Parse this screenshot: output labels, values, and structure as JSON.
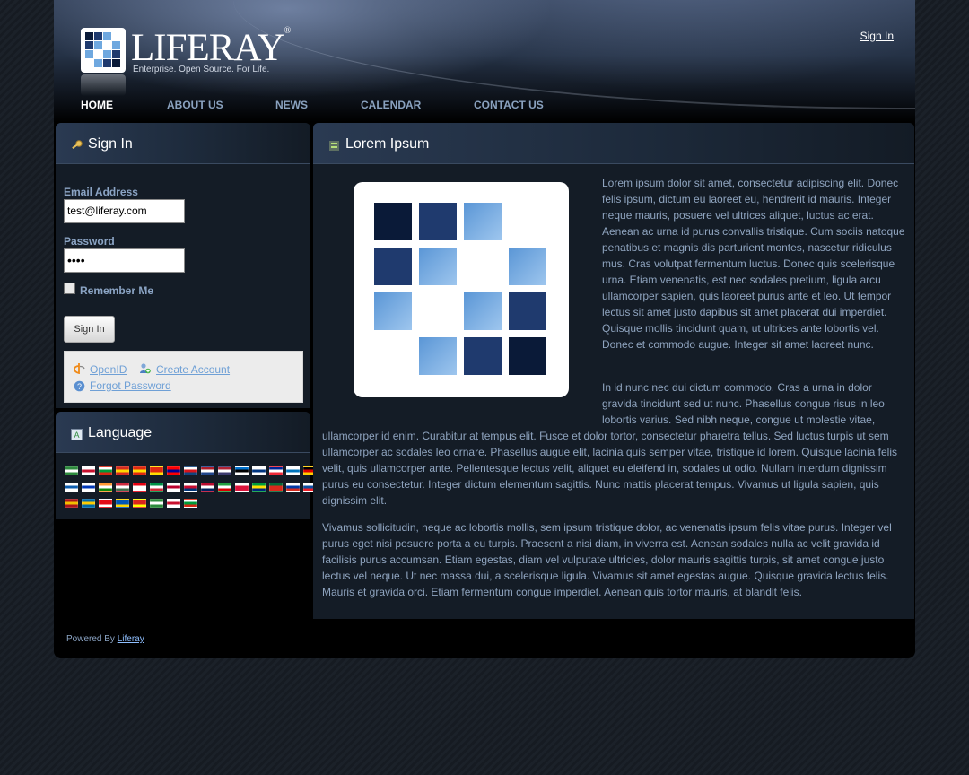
{
  "header": {
    "logo_word": "LIFERAY",
    "logo_tagline": "Enterprise. Open Source. For Life.",
    "sign_in_link": "Sign In"
  },
  "nav": {
    "items": [
      {
        "label": "HOME"
      },
      {
        "label": "ABOUT US"
      },
      {
        "label": "NEWS"
      },
      {
        "label": "CALENDAR"
      },
      {
        "label": "CONTACT US"
      }
    ]
  },
  "signin": {
    "title": "Sign In",
    "email_label": "Email Address",
    "email_value": "test@liferay.com",
    "password_label": "Password",
    "password_value": "••••",
    "remember_label": "Remember Me",
    "button": "Sign In",
    "openid": "OpenID",
    "create_account": "Create Account",
    "forgot_password": "Forgot Password"
  },
  "language": {
    "title": "Language",
    "flag_count": 38
  },
  "lorem": {
    "title": "Lorem Ipsum",
    "para1": "Lorem ipsum dolor sit amet, consectetur adipiscing elit. Donec felis ipsum, dictum eu laoreet eu, hendrerit id mauris. Integer neque mauris, posuere vel ultrices aliquet, luctus ac erat. Aenean ac urna id purus convallis tristique. Cum sociis natoque penatibus et magnis dis parturient montes, nascetur ridiculus mus. Cras volutpat fermentum luctus. Donec quis scelerisque urna. Etiam venenatis, est nec sodales pretium, ligula arcu ullamcorper sapien, quis laoreet purus ante et leo. Ut tempor lectus sit amet justo dapibus sit amet placerat dui imperdiet. Quisque mollis tincidunt quam, ut ultrices ante lobortis vel. Donec et commodo augue. Integer sit amet laoreet nunc.",
    "para2a": "In id nunc nec dui dictum commodo. Cras a urna in dolor gravida tincidunt sed ut nunc. Phasellus congue risus in leo lobortis varius. Sed nibh neque, congue ut molestie vitae,",
    "para2b": "ullamcorper id enim. Curabitur at tempus elit. Fusce et dolor tortor, consectetur pharetra tellus. Sed luctus turpis ut sem ullamcorper ac sodales leo ornare. Phasellus augue elit, lacinia quis semper vitae, tristique id lorem. Quisque lacinia felis velit, quis ullamcorper ante. Pellentesque lectus velit, aliquet eu eleifend in, sodales ut odio. Nullam interdum dignissim purus eu consectetur. Integer dictum elementum sagittis. Nunc mattis placerat tempus. Vivamus ut ligula sapien, quis dignissim elit.",
    "para3": "Vivamus sollicitudin, neque ac lobortis mollis, sem ipsum tristique dolor, ac venenatis ipsum felis vitae purus. Integer vel purus eget nisi posuere porta a eu turpis. Praesent a nisi diam, in viverra est. Aenean sodales nulla ac velit gravida id facilisis purus accumsan. Etiam egestas, diam vel vulputate ultricies, dolor mauris sagittis turpis, sit amet congue justo lectus vel neque. Ut nec massa dui, a scelerisque ligula. Vivamus sit amet egestas augue. Quisque gravida lectus felis. Mauris et gravida orci. Etiam fermentum congue imperdiet. Aenean quis tortor mauris, at blandit felis."
  },
  "footer": {
    "powered_by": "Powered By",
    "liferay_link": "Liferay"
  },
  "colors": {
    "accent": "#8aa2bf",
    "link": "#6fa0d6",
    "dark_navy": "#0a1a38",
    "mid_navy": "#1f3a6e",
    "light_blue": "#6fa8df"
  }
}
